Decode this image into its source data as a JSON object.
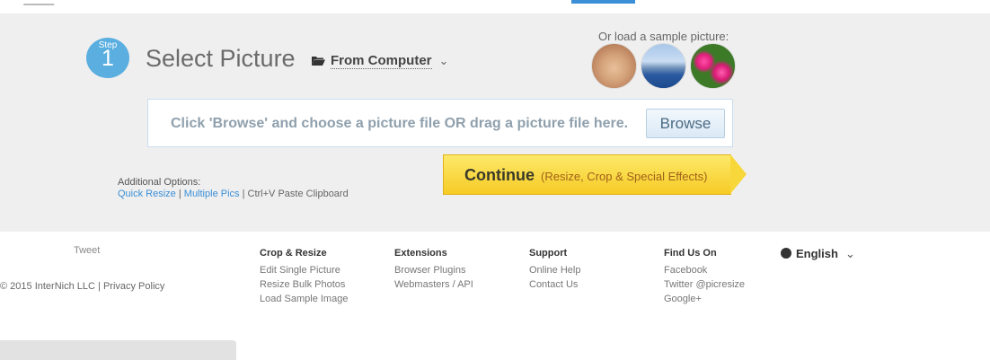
{
  "step": {
    "label": "Step",
    "number": "1"
  },
  "header": {
    "title": "Select Picture",
    "source_label": "From Computer",
    "source_chevron": "⌄"
  },
  "samples": {
    "label": "Or load a sample picture:",
    "items": [
      {
        "icon": "puppy-sample-thumbnail"
      },
      {
        "icon": "city-skyline-sample-thumbnail"
      },
      {
        "icon": "pink-flowers-sample-thumbnail"
      }
    ]
  },
  "dropzone": {
    "text": "Click 'Browse' and choose a picture file OR drag a picture file here.",
    "browse_label": "Browse"
  },
  "options": {
    "label": "Additional Options:",
    "quick_resize": "Quick Resize",
    "sep1": "|",
    "multiple_pics": "Multiple Pics",
    "sep2": "|",
    "paste": "Ctrl+V Paste Clipboard"
  },
  "continue": {
    "main": "Continue",
    "sub": "(Resize, Crop & Special Effects)"
  },
  "footer": {
    "tweet": "Tweet",
    "copyright": "© 2015 InterNich LLC",
    "sep": "|",
    "privacy": "Privacy Policy",
    "columns": [
      {
        "heading": "Crop & Resize",
        "links": [
          "Edit Single Picture",
          "Resize Bulk Photos",
          "Load Sample Image"
        ]
      },
      {
        "heading": "Extensions",
        "links": [
          "Browser Plugins",
          "Webmasters / API"
        ]
      },
      {
        "heading": "Support",
        "links": [
          "Online Help",
          "Contact Us"
        ]
      },
      {
        "heading": "Find Us On",
        "links": [
          "Facebook",
          "Twitter @picresize",
          "Google+"
        ]
      }
    ],
    "language": "English",
    "language_chevron": "⌄"
  },
  "colors": {
    "accent": "#3a8fd6",
    "step_circle": "#5aaee0",
    "continue_yellow": "#f6cb25",
    "panel_bg": "#efefef"
  }
}
